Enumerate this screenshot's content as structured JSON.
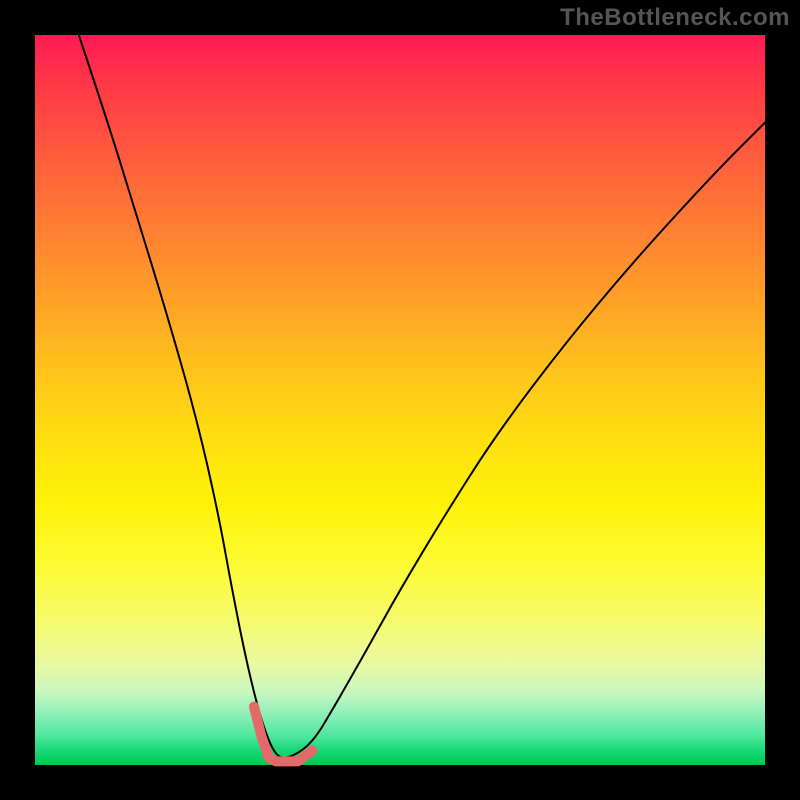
{
  "watermark": "TheBottleneck.com",
  "chart_data": {
    "type": "line",
    "title": "",
    "xlabel": "",
    "ylabel": "",
    "xlim": [
      0,
      100
    ],
    "ylim": [
      0,
      100
    ],
    "grid": false,
    "legend": false,
    "background_gradient": {
      "direction": "vertical",
      "stops": [
        {
          "pos": 0,
          "color": "#ff1a55"
        },
        {
          "pos": 50,
          "color": "#ffd000"
        },
        {
          "pos": 100,
          "color": "#00c94f"
        }
      ]
    },
    "series": [
      {
        "name": "bottleneck-curve",
        "color": "#000000",
        "width": 2,
        "x": [
          6,
          10,
          14,
          18,
          22,
          25,
          27,
          29,
          31,
          33,
          35,
          38,
          41,
          45,
          50,
          56,
          63,
          72,
          82,
          93,
          100
        ],
        "values": [
          100,
          88,
          75,
          62,
          48,
          35,
          24,
          14,
          6,
          1,
          1,
          3,
          8,
          15,
          24,
          34,
          45,
          57,
          69,
          81,
          88
        ]
      },
      {
        "name": "highlight-region",
        "color": "#e46a6a",
        "width": 10,
        "x": [
          30,
          31,
          32,
          33,
          34,
          36,
          38
        ],
        "values": [
          8,
          4,
          1,
          0.5,
          0.5,
          0.5,
          2
        ]
      }
    ],
    "minimum_point": {
      "x": 33,
      "y": 0.5
    }
  }
}
